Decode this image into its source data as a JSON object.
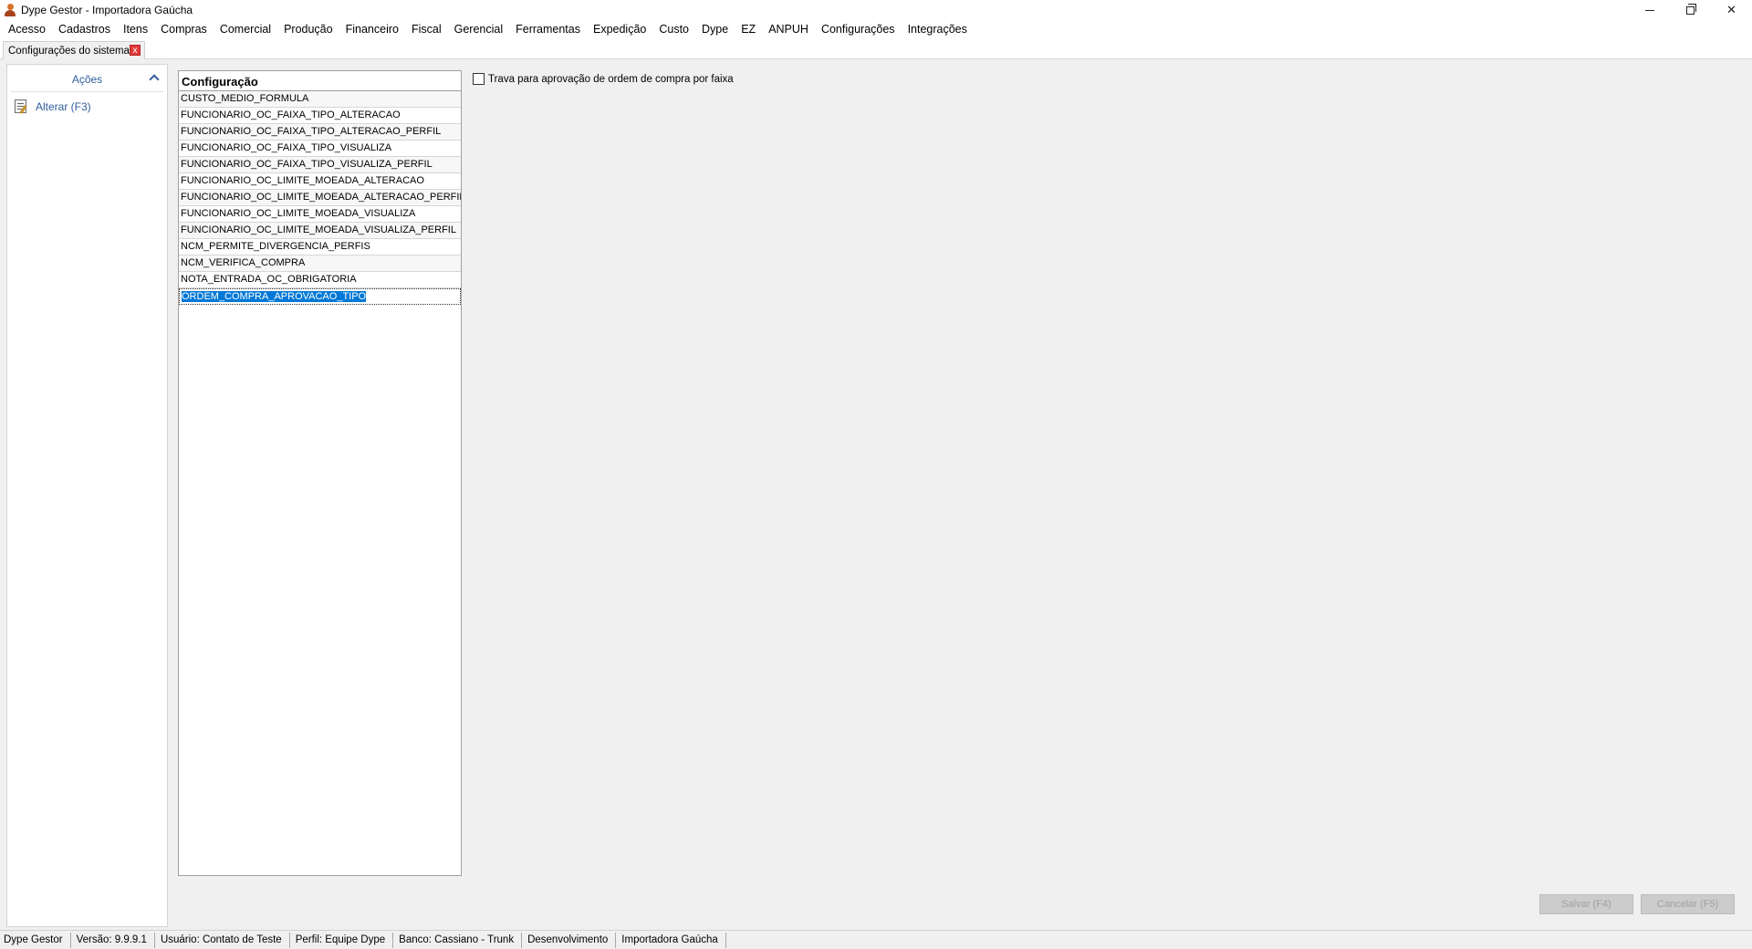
{
  "window": {
    "title": "Dype Gestor - Importadora Gaúcha",
    "icon": "app-user-icon",
    "controls": {
      "close_glyph": "✕"
    }
  },
  "menu": [
    "Acesso",
    "Cadastros",
    "Itens",
    "Compras",
    "Comercial",
    "Produção",
    "Financeiro",
    "Fiscal",
    "Gerencial",
    "Ferramentas",
    "Expedição",
    "Custo",
    "Dype",
    "EZ",
    "ANPUH",
    "Configurações",
    "Integrações"
  ],
  "tab": {
    "label": "Configurações do sistema",
    "close_glyph": "x"
  },
  "sidebar": {
    "header": "Ações",
    "actions": [
      {
        "label": "Alterar (F3)",
        "icon": "edit-icon"
      }
    ]
  },
  "config_list": {
    "header": "Configuração",
    "rows": [
      "CUSTO_MEDIO_FORMULA",
      "FUNCIONARIO_OC_FAIXA_TIPO_ALTERACAO",
      "FUNCIONARIO_OC_FAIXA_TIPO_ALTERACAO_PERFIL",
      "FUNCIONARIO_OC_FAIXA_TIPO_VISUALIZA",
      "FUNCIONARIO_OC_FAIXA_TIPO_VISUALIZA_PERFIL",
      "FUNCIONARIO_OC_LIMITE_MOEADA_ALTERACAO",
      "FUNCIONARIO_OC_LIMITE_MOEADA_ALTERACAO_PERFIL",
      "FUNCIONARIO_OC_LIMITE_MOEADA_VISUALIZA",
      "FUNCIONARIO_OC_LIMITE_MOEADA_VISUALIZA_PERFIL",
      "NCM_PERMITE_DIVERGENCIA_PERFIS",
      "NCM_VERIFICA_COMPRA",
      "NOTA_ENTRADA_OC_OBRIGATORIA",
      "ORDEM_COMPRA_APROVACAO_TIPO"
    ],
    "selected_row": "ORDEM_COMPRA_APROVACAO_TIPO"
  },
  "detail": {
    "checkbox_label": "Trava para aprovação de ordem de compra por faixa",
    "checkbox_checked": false
  },
  "buttons": {
    "save": "Salvar (F4)",
    "cancel": "Cancelar (F5)"
  },
  "statusbar": [
    "Dype Gestor",
    "Versão: 9.9.9.1",
    "Usuário: Contato de Teste",
    "Perfil: Equipe Dype",
    "Banco: Cassiano  - Trunk",
    "Desenvolvimento",
    "Importadora Gaúcha"
  ],
  "colors": {
    "accent": "#0078d7",
    "link": "#2f5c9c",
    "tab_close": "#e23c3c"
  }
}
